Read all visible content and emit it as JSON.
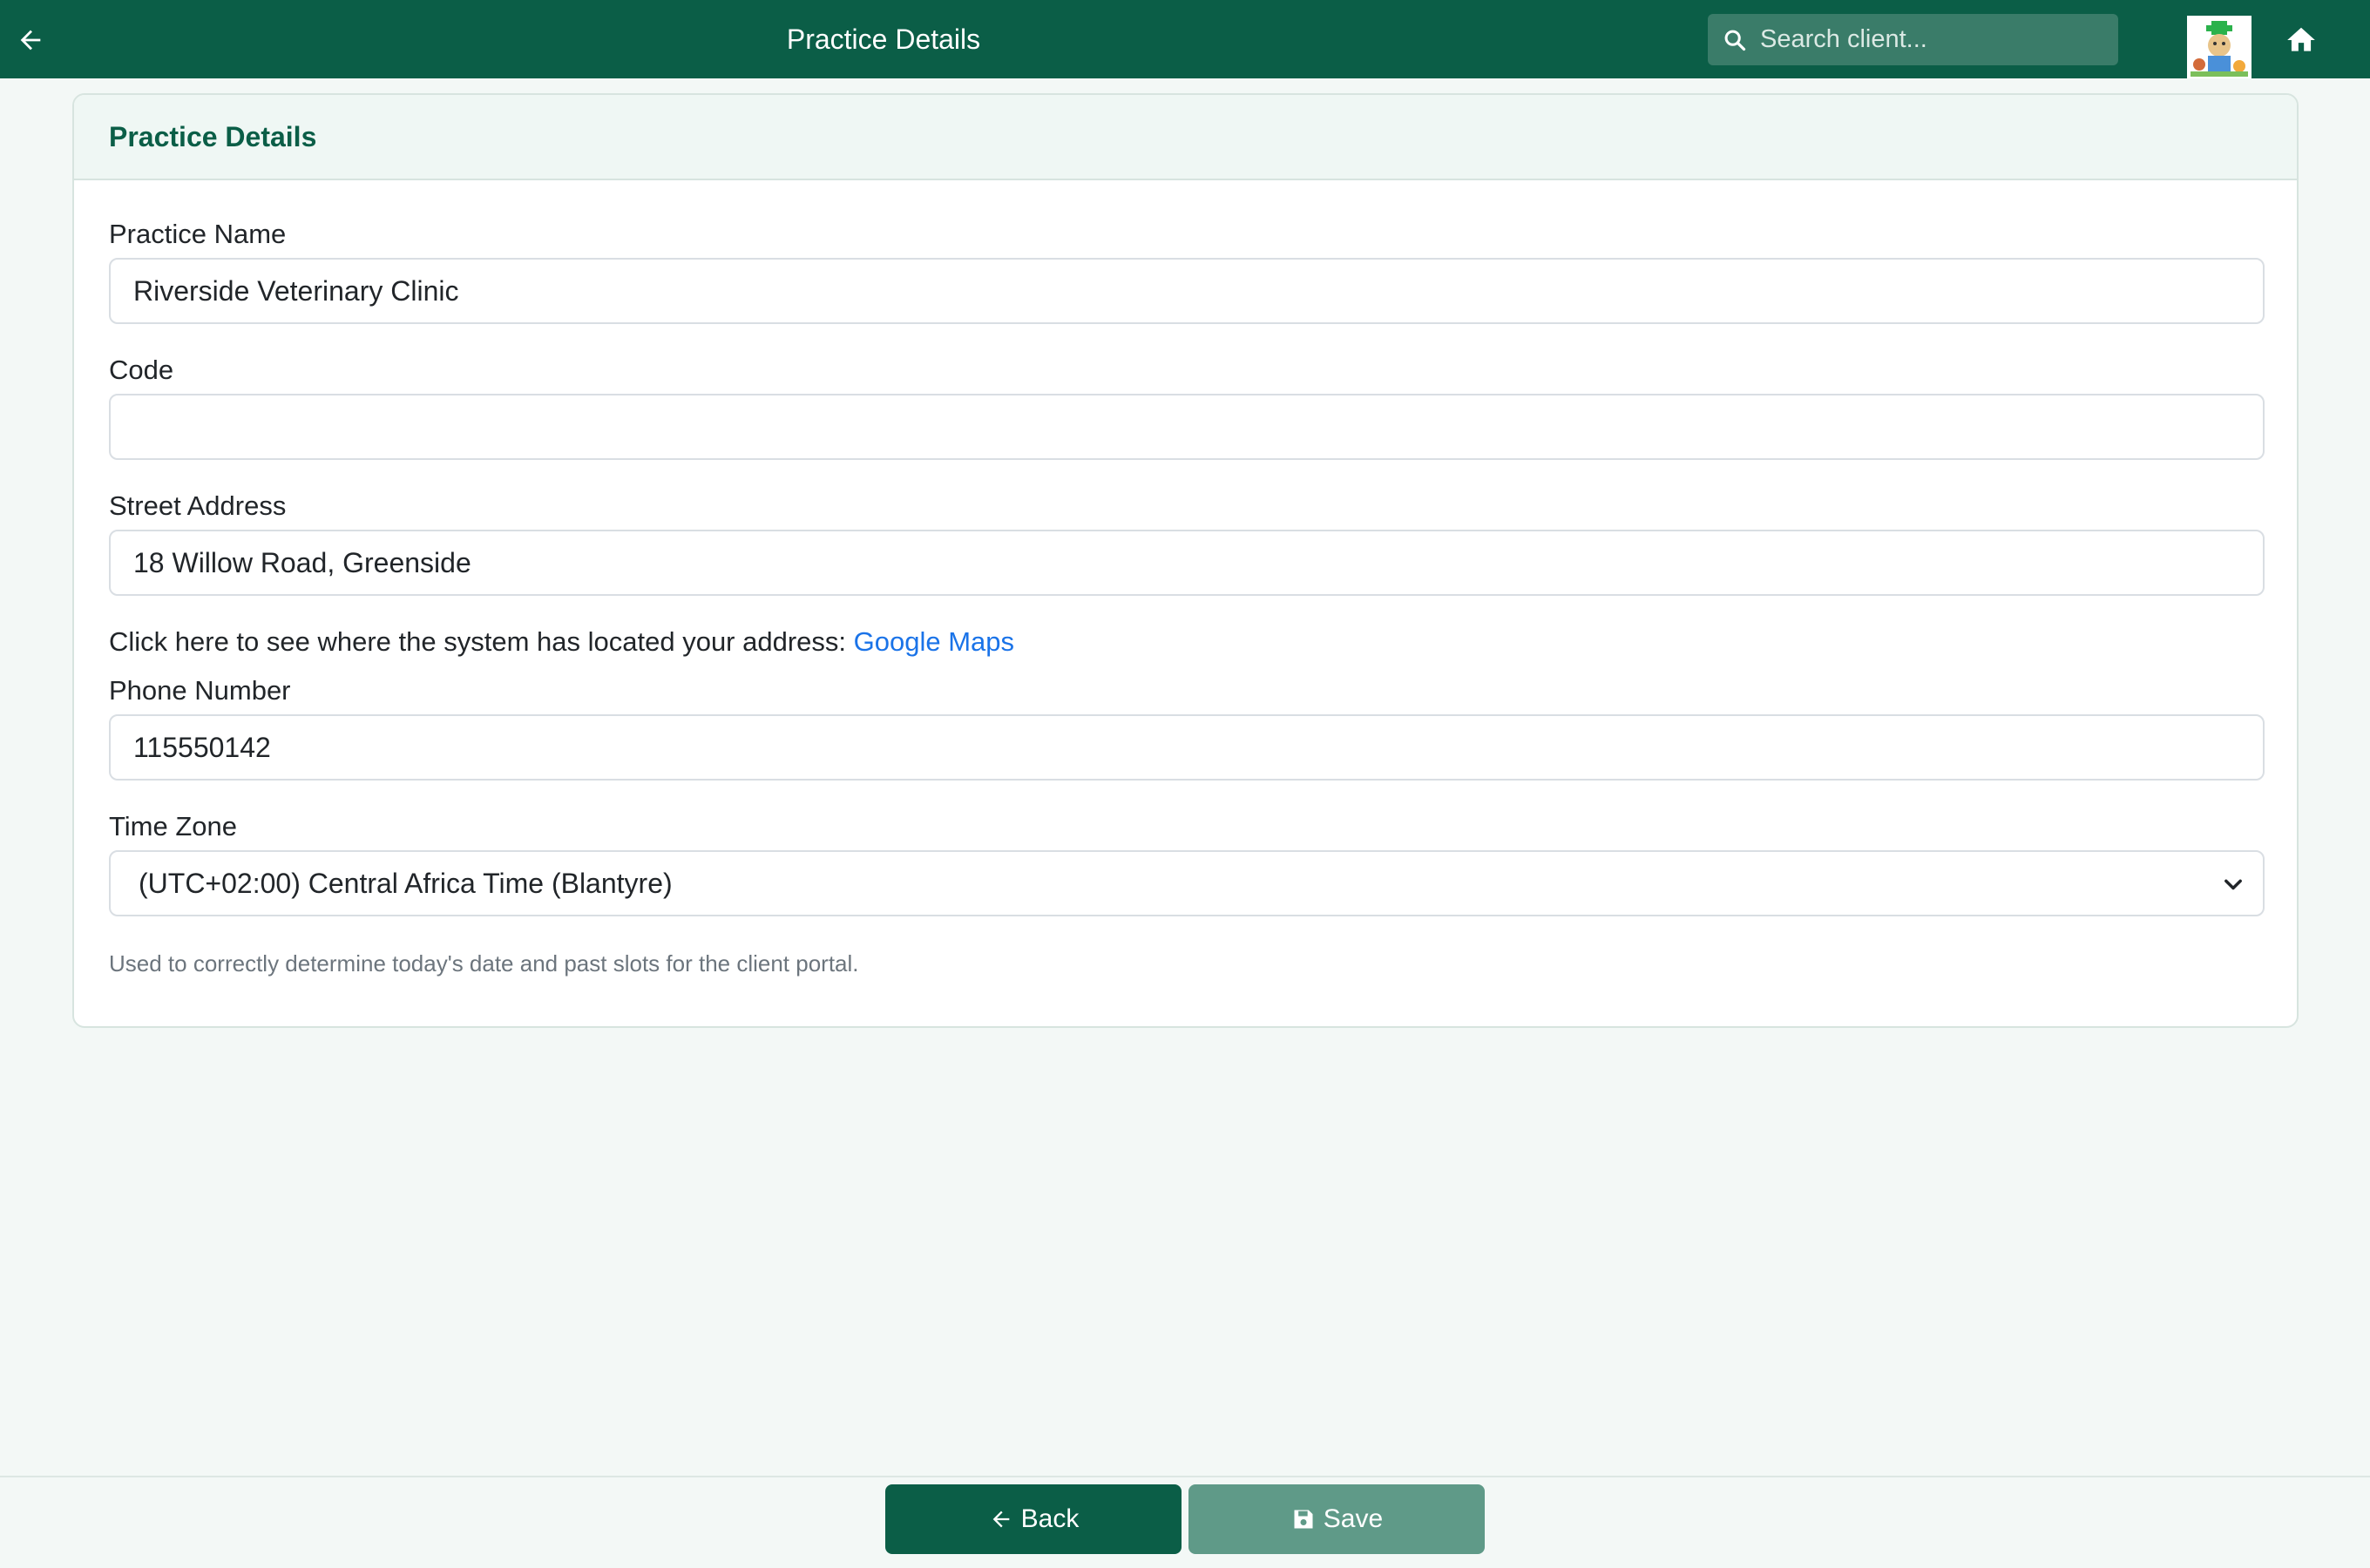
{
  "header": {
    "title": "Practice Details",
    "search_placeholder": "Search client..."
  },
  "card": {
    "title": "Practice Details",
    "fields": {
      "practice_name": {
        "label": "Practice Name",
        "value": "Riverside Veterinary Clinic"
      },
      "code": {
        "label": "Code",
        "value": ""
      },
      "street_address": {
        "label": "Street Address",
        "value": "18 Willow Road, Greenside"
      },
      "phone_number": {
        "label": "Phone Number",
        "value": "115550142"
      },
      "time_zone": {
        "label": "Time Zone",
        "value": "(UTC+02:00) Central Africa Time (Blantyre)"
      }
    },
    "map_prompt": "Click here to see where the system has located your address:",
    "map_link": "Google Maps",
    "help_text": "Used to correctly determine today's date and past slots for the client portal."
  },
  "footer": {
    "back_label": "Back",
    "save_label": "Save"
  },
  "colors": {
    "primary": "#0b5e47",
    "save_button": "#5f9a88",
    "link": "#1a73e8"
  },
  "icons": [
    "arrow-left-icon",
    "search-icon",
    "home-icon",
    "floppy-disk-icon",
    "chevron-down-icon"
  ]
}
